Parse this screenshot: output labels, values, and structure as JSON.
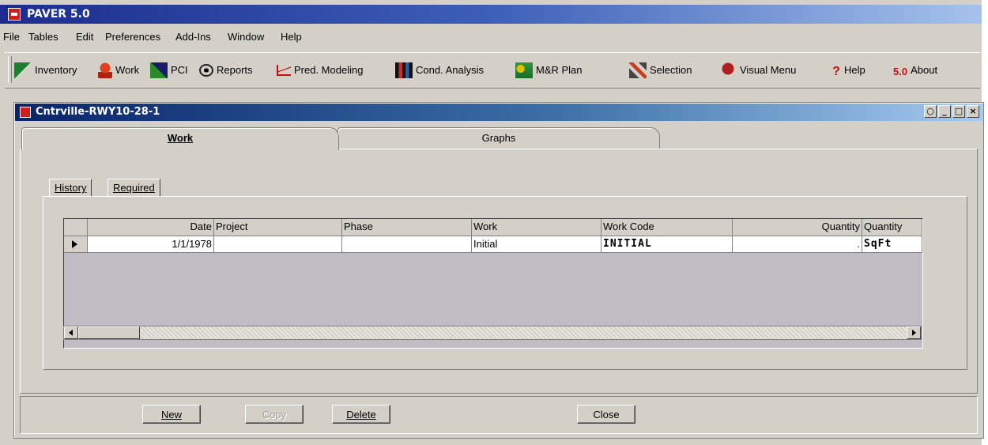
{
  "app": {
    "title": "PAVER 5.0"
  },
  "menu": [
    "File",
    "Tables",
    "Edit",
    "Preferences",
    "Add-Ins",
    "Window",
    "Help"
  ],
  "toolbar": {
    "inventory": "Inventory",
    "work": "Work",
    "pci": "PCI",
    "reports": "Reports",
    "pred_modeling": "Pred. Modeling",
    "cond_analysis": "Cond. Analysis",
    "mr_plan": "M&R Plan",
    "selection": "Selection",
    "visual_menu": "Visual Menu",
    "help": "Help",
    "about_badge": "5.0",
    "about": "About"
  },
  "child": {
    "title": "Cntrville-RWY10-28-1",
    "tabs": {
      "work": "Work",
      "graphs": "Graphs"
    },
    "subtabs": {
      "history": "History",
      "required": "Required"
    },
    "grid": {
      "headers": [
        "Date",
        "Project",
        "Phase",
        "Work",
        "Work Code",
        "Quantity",
        "Quantity"
      ],
      "rows": [
        {
          "date": "1/1/1978",
          "project": "",
          "phase": "",
          "work": "Initial",
          "work_code": "INITIAL",
          "quantity": ".",
          "unit": "SqFt"
        }
      ]
    },
    "buttons": {
      "new": "New",
      "copy": "Copy",
      "delete": "Delete",
      "close": "Close"
    }
  }
}
